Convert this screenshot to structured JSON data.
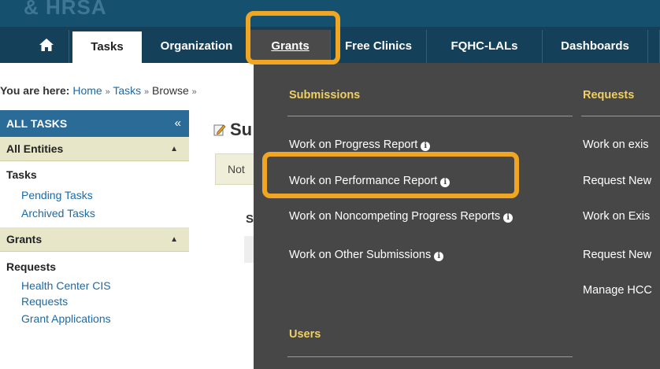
{
  "banner": {
    "logo_text": "& HRSA"
  },
  "nav": {
    "items": [
      {
        "label": "Tasks"
      },
      {
        "label": "Organization"
      },
      {
        "label": "Grants"
      },
      {
        "label": "Free Clinics"
      },
      {
        "label": "FQHC-LALs"
      },
      {
        "label": "Dashboards"
      }
    ],
    "home_icon": "home-icon"
  },
  "breadcrumb": {
    "prefix": "You are here:",
    "home": "Home",
    "tasks": "Tasks",
    "browse": "Browse",
    "sep": "»"
  },
  "sidebar": {
    "header": "ALL TASKS",
    "collapse_glyph": "«",
    "sections": [
      {
        "title": "All Entities"
      },
      {
        "title": "Grants"
      }
    ],
    "tasks_label": "Tasks",
    "tasks_links": [
      "Pending Tasks",
      "Archived Tasks"
    ],
    "requests_label": "Requests",
    "requests_links": [
      "Health Center CIS",
      "Requests",
      "Grant Applications"
    ]
  },
  "content": {
    "title_fragment": "Su",
    "notice_fragment": "Not",
    "s_fragment": "S"
  },
  "dropdown": {
    "submissions_header": "Submissions",
    "requests_header": "Requests",
    "users_header": "Users",
    "submissions": [
      "Work on Progress Report",
      "Work on Performance Report",
      "Work on Noncompeting Progress Reports",
      "Work on Other Submissions"
    ],
    "requests": [
      "Work on exis",
      "Request New",
      "Work on Exis",
      "Request New",
      "Manage HCC"
    ]
  },
  "colors": {
    "highlight": "#f0a623",
    "nav_bg": "#14405a",
    "dropdown_bg": "#474747",
    "dropdown_header": "#f0d060"
  }
}
